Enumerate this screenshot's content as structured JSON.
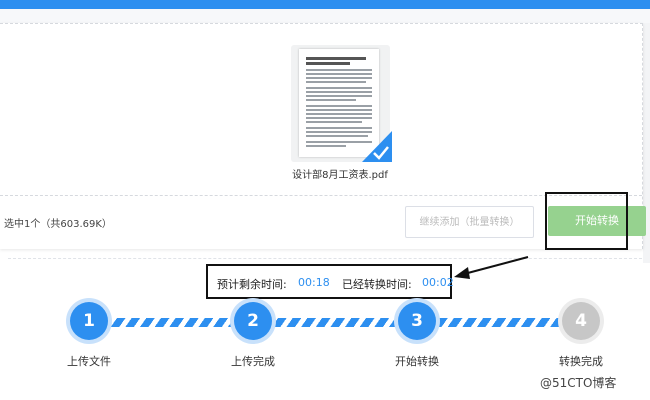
{
  "file": {
    "name": "设计部8月工资表.pdf",
    "selected": true
  },
  "toolbar": {
    "selection_info": "选中1个（共603.69K）",
    "add_button": "继续添加（批量转换）",
    "start_button": "开始转换"
  },
  "timing": {
    "remaining_label": "预计剩余时间:",
    "remaining_value": "00:18",
    "elapsed_label": "已经转换时间:",
    "elapsed_value": "00:02"
  },
  "steps": [
    {
      "number": "1",
      "label": "上传文件",
      "state": "done"
    },
    {
      "number": "2",
      "label": "上传完成",
      "state": "done"
    },
    {
      "number": "3",
      "label": "开始转换",
      "state": "current"
    },
    {
      "number": "4",
      "label": "转换完成",
      "state": "pending"
    }
  ],
  "watermark": "@51CTO博客",
  "colors": {
    "accent": "#2d8ff0",
    "start_button": "#96d28f",
    "pending_step": "#c7c7c7"
  },
  "icons": {
    "check": "checkmark-corner-icon",
    "arrow": "annotation-arrow-icon"
  }
}
